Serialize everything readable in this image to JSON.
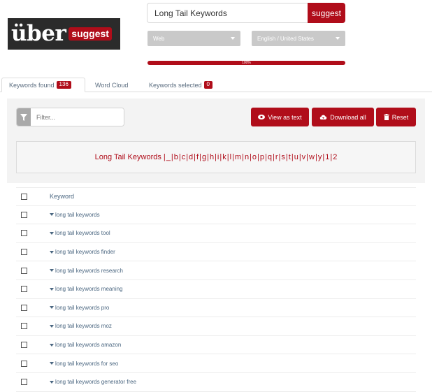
{
  "logo": {
    "brand": "über",
    "tag": "suggest"
  },
  "search": {
    "value": "Long Tail Keywords",
    "button_label": "suggest"
  },
  "filters": {
    "source": "Web",
    "language": "English / United States"
  },
  "progress": {
    "percent": 100,
    "label": "100%"
  },
  "tabs": [
    {
      "label": "Keywords found",
      "badge": "136"
    },
    {
      "label": "Word Cloud"
    },
    {
      "label": "Keywords selected",
      "badge": "0"
    }
  ],
  "filter": {
    "placeholder": "Filter..."
  },
  "actions": {
    "view_as_text": "View as text",
    "download_all": "Download all",
    "reset": "Reset"
  },
  "letters": {
    "main": "Long Tail Keywords",
    "items": [
      "_",
      "b",
      "c",
      "d",
      "f",
      "g",
      "h",
      "i",
      "k",
      "l",
      "m",
      "n",
      "o",
      "p",
      "q",
      "r",
      "s",
      "t",
      "u",
      "v",
      "w",
      "y",
      "1",
      "2"
    ]
  },
  "table": {
    "header": "Keyword",
    "rows": [
      "long tail keywords",
      "long tail keywords tool",
      "long tail keywords finder",
      "long tail keywords research",
      "long tail keywords meaning",
      "long tail keywords pro",
      "long tail keywords moz",
      "long tail keywords amazon",
      "long tail keywords for seo",
      "long tail keywords generator free"
    ]
  },
  "colors": {
    "accent": "#b00d1a",
    "link": "#4b6781",
    "panel": "#f3f3f3"
  }
}
